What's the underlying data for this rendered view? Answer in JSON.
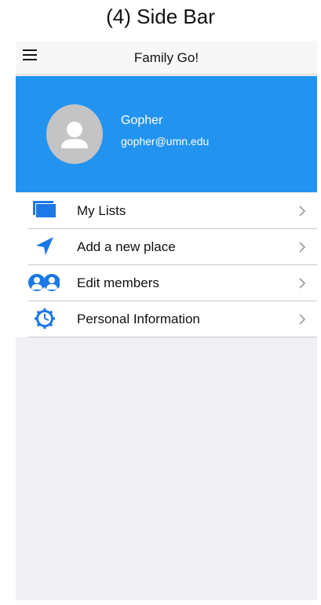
{
  "caption": "(4) Side Bar",
  "navbar": {
    "title": "Family Go!",
    "menu_icon": "hamburger-menu-icon"
  },
  "profile": {
    "name": "Gopher",
    "email": "gopher@umn.edu",
    "avatar_icon": "person-avatar-icon"
  },
  "menu": {
    "items": [
      {
        "label": "My Lists",
        "icon": "lists-icon"
      },
      {
        "label": "Add a new place",
        "icon": "navigation-arrow-icon"
      },
      {
        "label": "Edit members",
        "icon": "members-icon"
      },
      {
        "label": "Personal Information",
        "icon": "settings-gear-icon"
      }
    ],
    "chevron_icon": "chevron-right-icon"
  },
  "colors": {
    "accent": "#2393f0",
    "icon_blue": "#1c78e6",
    "background": "#efeff4"
  }
}
